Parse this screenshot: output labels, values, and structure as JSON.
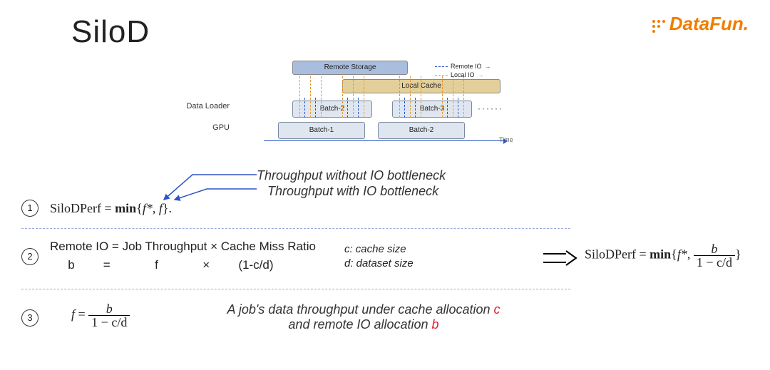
{
  "title": "SiloD",
  "logo": {
    "text": "DataFun",
    "dot": "."
  },
  "arch": {
    "remote": "Remote Storage",
    "local": "Local Cache",
    "batch2": "Batch-2",
    "batch3": "Batch-3",
    "batch1": "Batch-1",
    "batch2_gpu": "Batch-2",
    "dl_label": "Data Loader",
    "gpu_label": "GPU",
    "time_label": "Time",
    "ellipsis": "······",
    "legend_remote": "Remote IO",
    "legend_local": "Local IO"
  },
  "sec1": {
    "num": "1",
    "formula_lhs": "SiloDPerf",
    "min": "min",
    "f_star": "f*",
    "f": "f",
    "period": ".",
    "ann_top": "Throughput without IO bottleneck",
    "ann_bot": "Throughput with IO bottleneck"
  },
  "sec2": {
    "num": "2",
    "line1": "Remote IO = Job Throughput × Cache Miss Ratio",
    "l2_a": "b",
    "l2_b": "=",
    "l2_c": "f",
    "l2_d": "×",
    "l2_e": "(1-c/d)",
    "def_c": "c: cache size",
    "def_d": "d: dataset size"
  },
  "sec3": {
    "num": "3",
    "lhs": "f",
    "eq": "=",
    "num_frac": "b",
    "den_frac": "1 − c/d",
    "ann_a": "A job's data throughput under cache allocation ",
    "ann_c": "c",
    "ann_b": " and remote IO allocation ",
    "ann_d": "b"
  },
  "result": {
    "lhs": "SiloDPerf",
    "min": "min",
    "f_star": "f*",
    "num": "b",
    "den": "1 − c/d"
  }
}
